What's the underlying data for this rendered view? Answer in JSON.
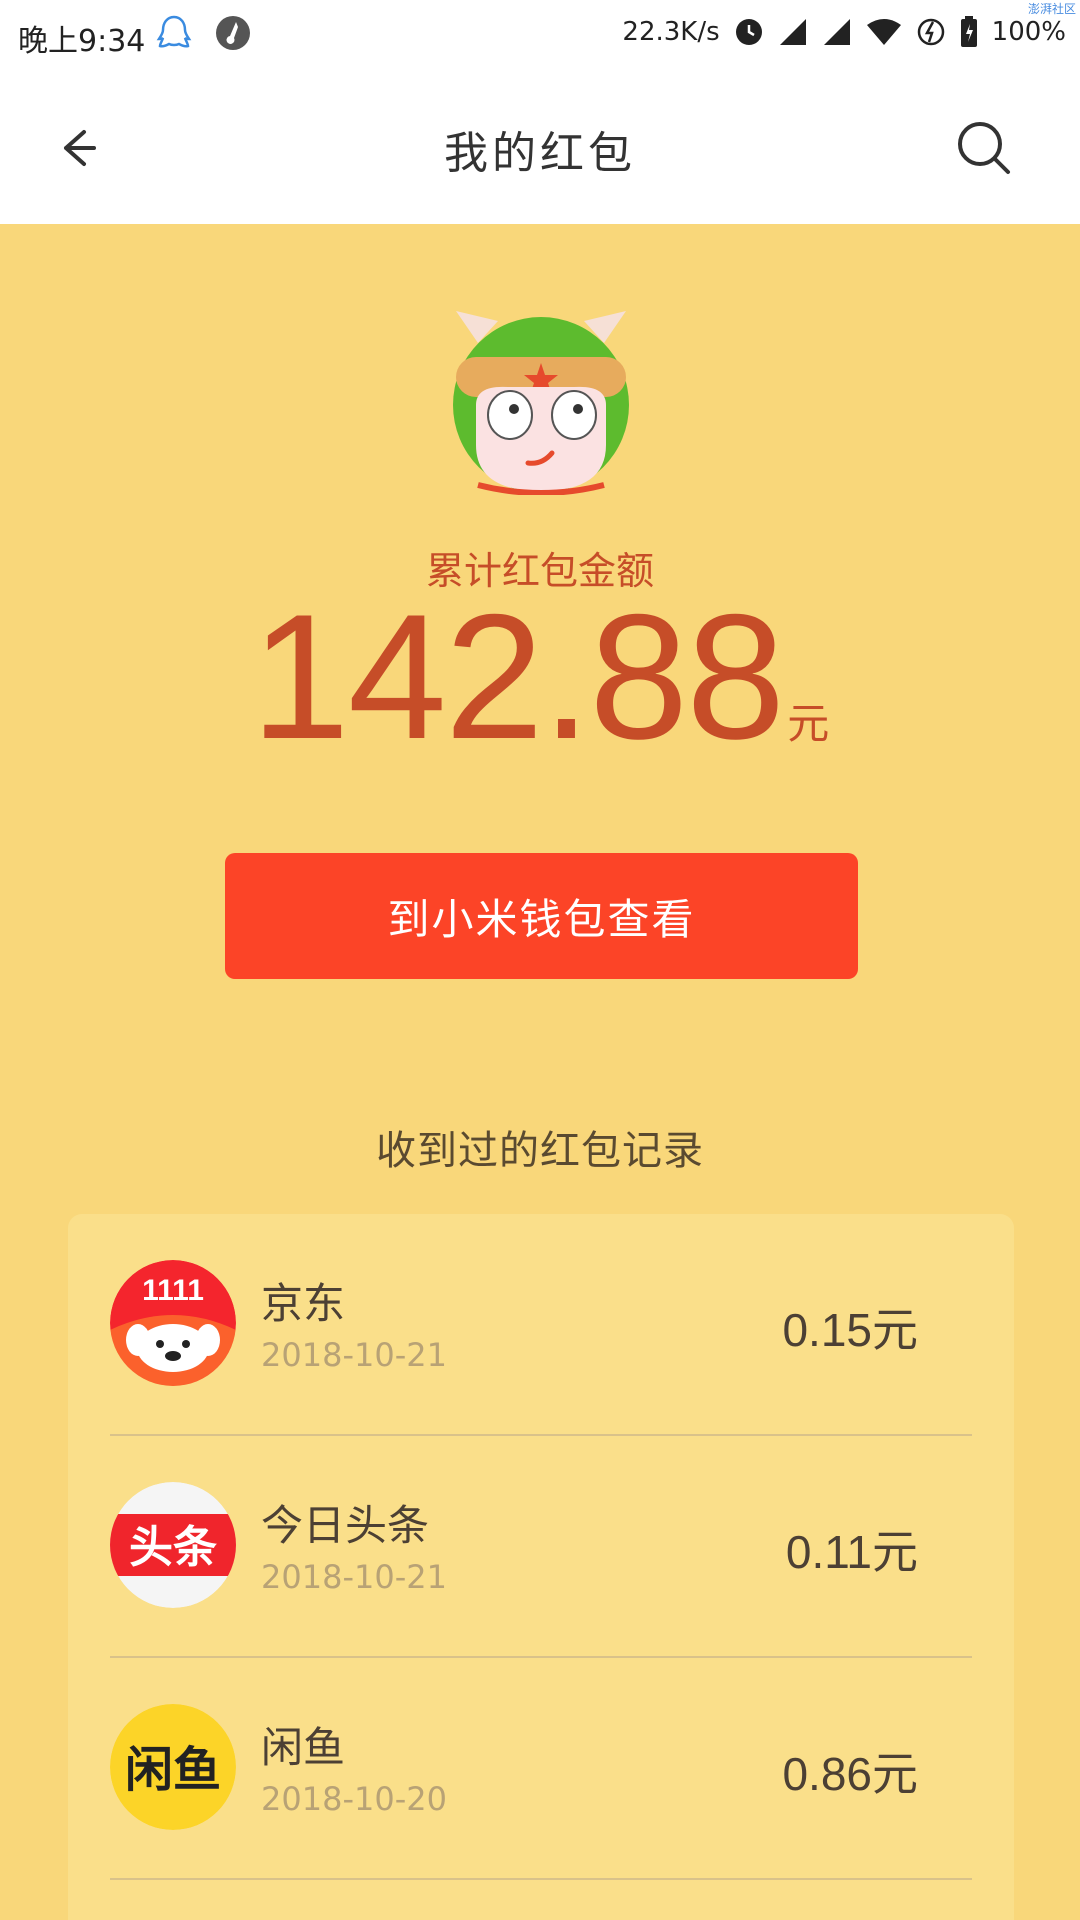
{
  "status_bar": {
    "time": "晚上9:34",
    "network_speed": "22.3K/s",
    "battery": "100%",
    "watermark": "澎湃社区",
    "icons": [
      "qq-icon",
      "music-app-icon",
      "alarm-icon",
      "signal-icon",
      "signal-icon-2",
      "wifi-icon",
      "no-disturb-icon",
      "battery-icon"
    ]
  },
  "header": {
    "title": "我的红包",
    "back_icon": "back-arrow-icon",
    "search_icon": "search-icon"
  },
  "summary": {
    "label": "累计红包金额",
    "amount": "142.88",
    "unit": "元"
  },
  "wallet_button": {
    "label": "到小米钱包查看"
  },
  "records": {
    "title": "收到过的红包记录",
    "items": [
      {
        "name": "京东",
        "date": "2018-10-21",
        "amount": "0.15元",
        "logo": "jd-logo"
      },
      {
        "name": "今日头条",
        "date": "2018-10-21",
        "amount": "0.11元",
        "logo": "toutiao-logo"
      },
      {
        "name": "闲鱼",
        "date": "2018-10-20",
        "amount": "0.86元",
        "logo": "xianyu-logo"
      }
    ]
  },
  "colors": {
    "background": "#f9d77a",
    "accent_red": "#fc4427",
    "amount_text": "#c64d28",
    "card": "#fadf8a"
  }
}
